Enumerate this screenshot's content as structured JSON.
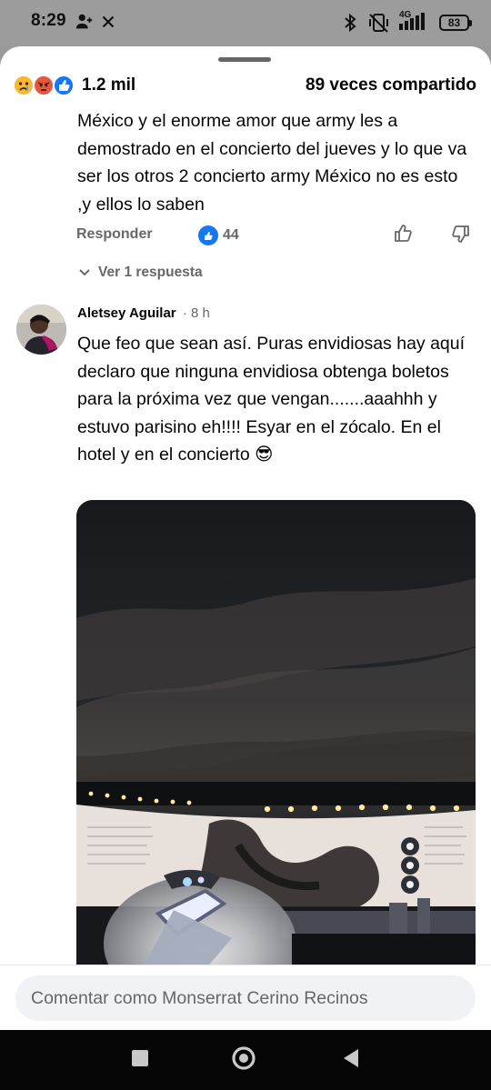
{
  "status_bar": {
    "time": "8:29",
    "network": "4G",
    "battery": "83",
    "icons": [
      "person-add-icon",
      "close-icon",
      "bluetooth-icon",
      "vibrate-off-icon",
      "signal-icon",
      "battery-icon"
    ]
  },
  "post_summary": {
    "reactions": [
      "sad-reaction-icon",
      "angry-reaction-icon",
      "like-reaction-icon"
    ],
    "reaction_count": "1.2 mil",
    "shares": "89 veces compartido"
  },
  "comments": [
    {
      "text": "México y el enorme amor que army les a demostrado en el concierto del jueves y lo que va ser los otros 2 concierto army México no es esto ,y ellos lo saben",
      "reply_label": "Responder",
      "like_count": "44",
      "view_replies": "Ver 1 respuesta"
    },
    {
      "author": "Aletsey Aguilar",
      "time": "· 8 h",
      "text": "Que feo que sean así. Puras envidiosas hay aquí declaro que ninguna envidiosa obtenga boletos para la próxima vez que vengan.......aaahhh y estuvo parisino eh!!!! Esyar en el zócalo. En el hotel y en el concierto 😎"
    }
  ],
  "composer": {
    "placeholder": "Comentar como Monserrat Cerino Recinos"
  },
  "colors": {
    "facebook_blue": "#1677f2",
    "secondary_text": "#65676b",
    "input_background": "#f0f2f5",
    "status_bar_overlay": "#9c9c9c"
  },
  "navigation": [
    "recent-apps-icon",
    "home-icon",
    "back-icon"
  ]
}
